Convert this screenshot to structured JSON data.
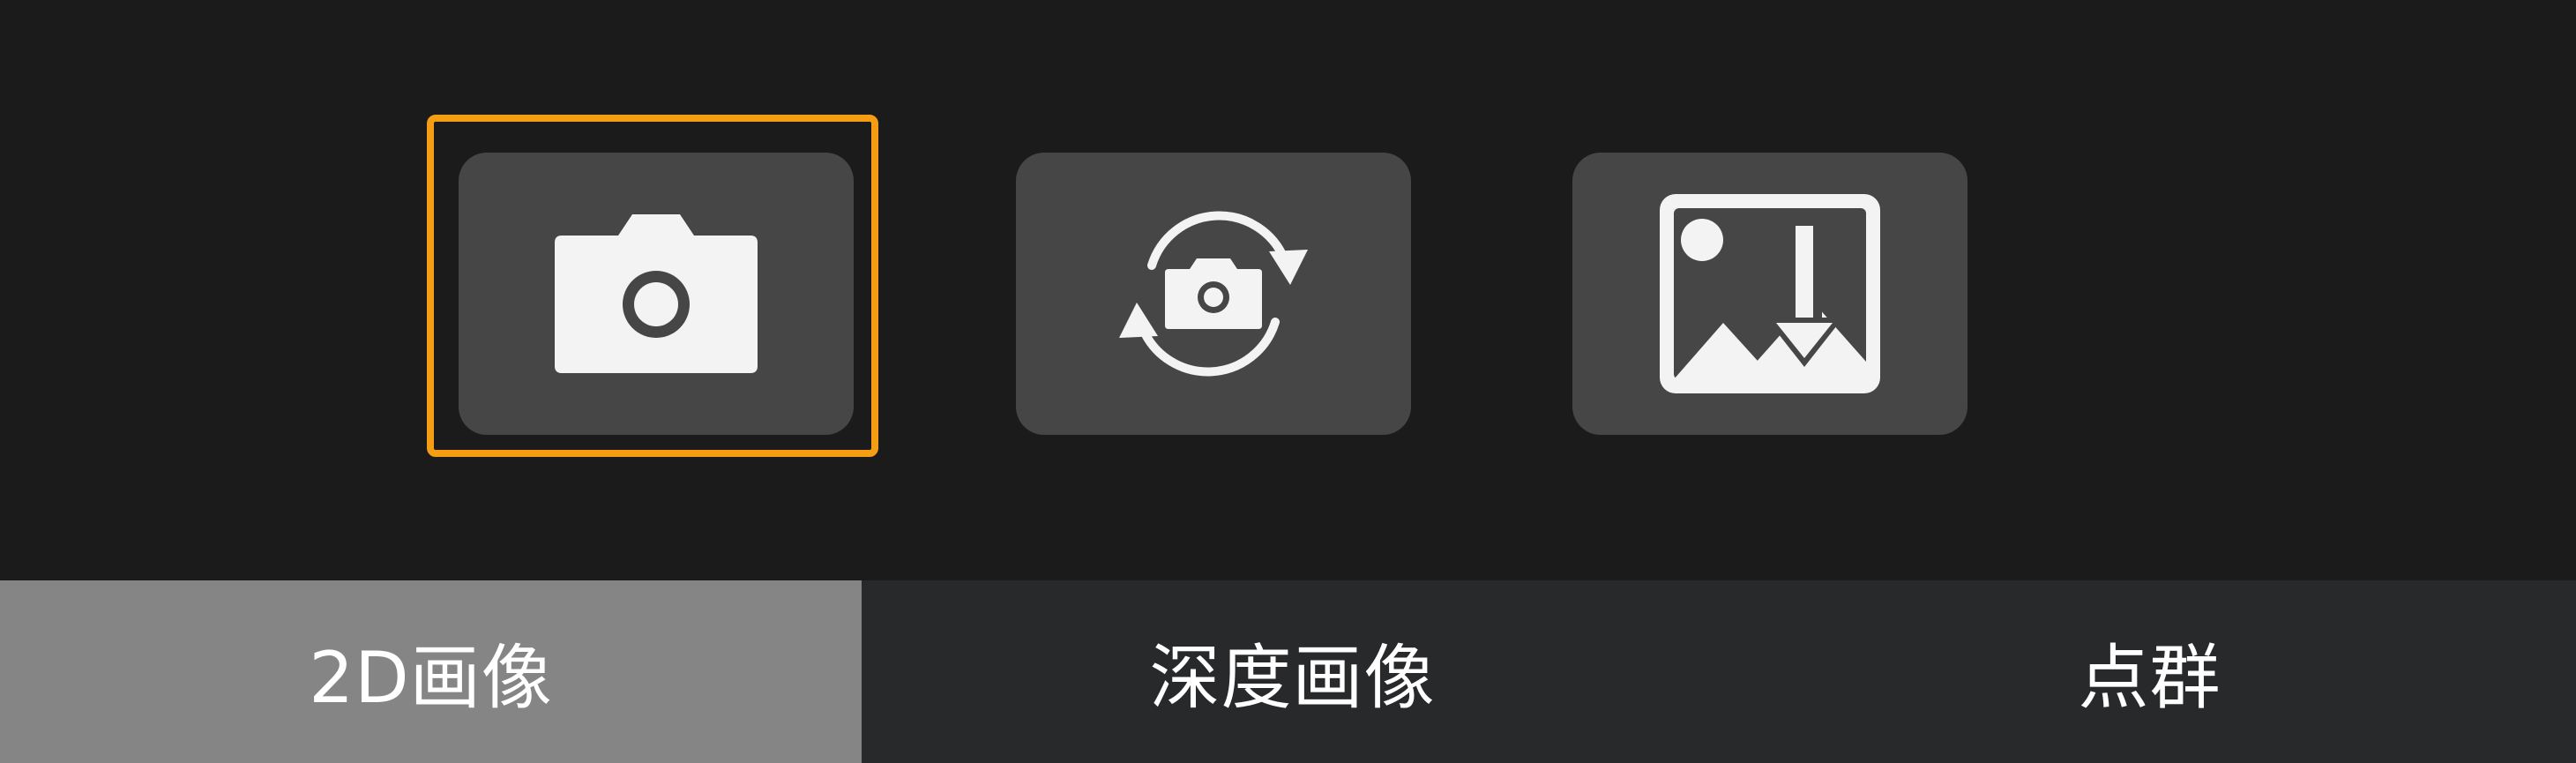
{
  "toolbar": {
    "buttons": [
      {
        "icon": "camera-icon",
        "selected": true
      },
      {
        "icon": "camera-rotate-icon",
        "selected": false
      },
      {
        "icon": "image-download-icon",
        "selected": false
      }
    ],
    "selected_color": "#f59d13"
  },
  "tabs": [
    {
      "label": "2D画像",
      "active": true
    },
    {
      "label": "深度画像",
      "active": false
    },
    {
      "label": "点群",
      "active": false
    }
  ]
}
